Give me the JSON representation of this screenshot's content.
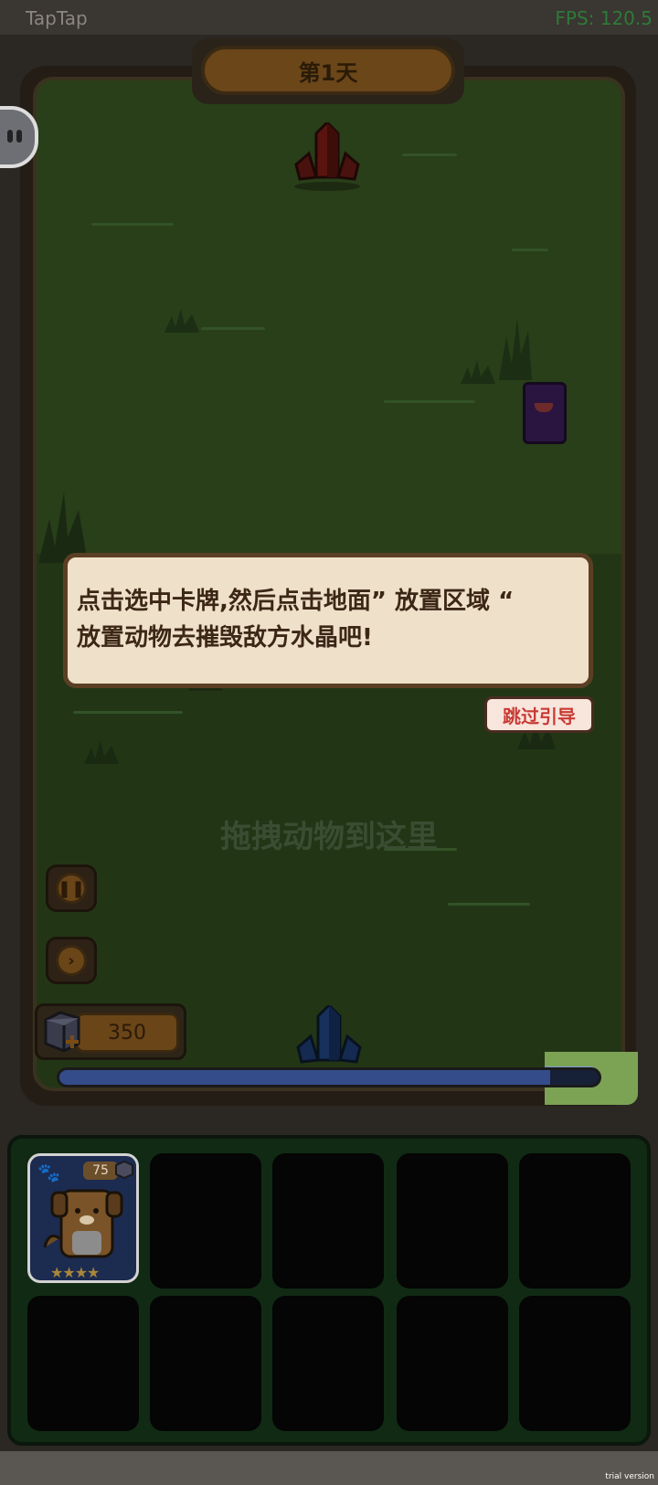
{
  "status_bar": {
    "app_name": "TapTap",
    "fps": "FPS: 120.5"
  },
  "game": {
    "day_label": "第1天",
    "tutorial": {
      "line1": "点击选中卡牌,然后点击地面” 放置区域 “",
      "line2": "放置动物去摧毁敌方水晶吧!",
      "skip_label": "跳过引导"
    },
    "drop_hint": "拖拽动物到这里",
    "resource": {
      "amount": "350"
    },
    "progress": {
      "fraction": 0.91
    }
  },
  "cards": [
    {
      "name": "dog",
      "cost": "75",
      "stars": "★★★★"
    }
  ],
  "footer": {
    "watermark": "trial version"
  },
  "colors": {
    "field_green": "#283f19",
    "dialog_bg": "#efe0c9",
    "skip_text": "#c83a33",
    "progress_fill": "#344d8a",
    "card_bg": "#1c2b50"
  }
}
